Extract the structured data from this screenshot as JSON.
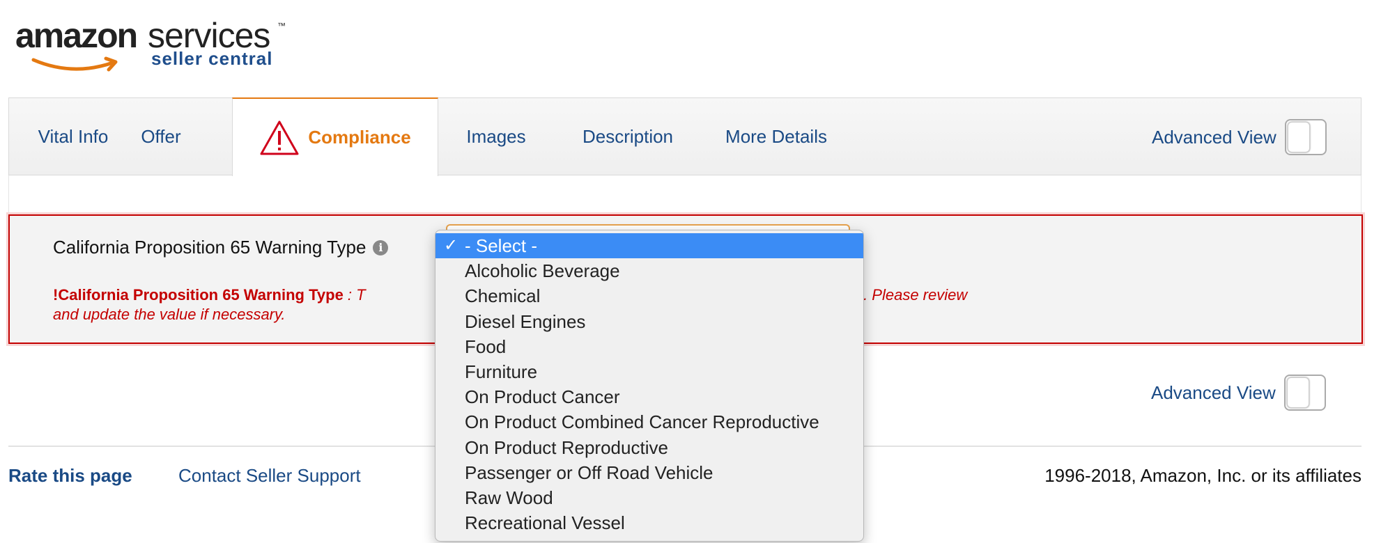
{
  "logo": {
    "brand": "amazon",
    "services": "services",
    "tm": "™",
    "subtitle": "seller central",
    "brand_color": "#e47911"
  },
  "tabs": [
    {
      "label": "Vital Info",
      "active": false
    },
    {
      "label": "Offer",
      "active": false
    },
    {
      "label": "Compliance",
      "active": true,
      "icon": "warning-triangle-icon"
    },
    {
      "label": "Images",
      "active": false
    },
    {
      "label": "Description",
      "active": false
    },
    {
      "label": "More Details",
      "active": false
    }
  ],
  "advanced_view_label": "Advanced View",
  "advanced_view_bottom_label": "Advanced View",
  "field": {
    "label": "California Proposition 65 Warning Type",
    "info_icon": "i",
    "error_bang": "!",
    "error_title": "California Proposition 65 Warning Type",
    "error_sep": " : T",
    "error_tail": "nissing. Please review",
    "error_line2": "and update the value if necessary."
  },
  "dropdown": {
    "check": "✓",
    "selected": "- Select -",
    "options": [
      "Alcoholic Beverage",
      "Chemical",
      "Diesel Engines",
      "Food",
      "Furniture",
      "On Product Cancer",
      "On Product Combined Cancer Reproductive",
      "On Product Reproductive",
      "Passenger or Off Road Vehicle",
      "Raw Wood",
      "Recreational Vessel"
    ]
  },
  "footer": {
    "rate": "Rate this page",
    "contact": "Contact Seller Support",
    "copyright": "1996-2018, Amazon, Inc. or its affiliates"
  },
  "colors": {
    "link": "#1a4a85",
    "active_tab": "#e47911",
    "error": "#c40000",
    "selected_option": "#3b8cf5"
  }
}
